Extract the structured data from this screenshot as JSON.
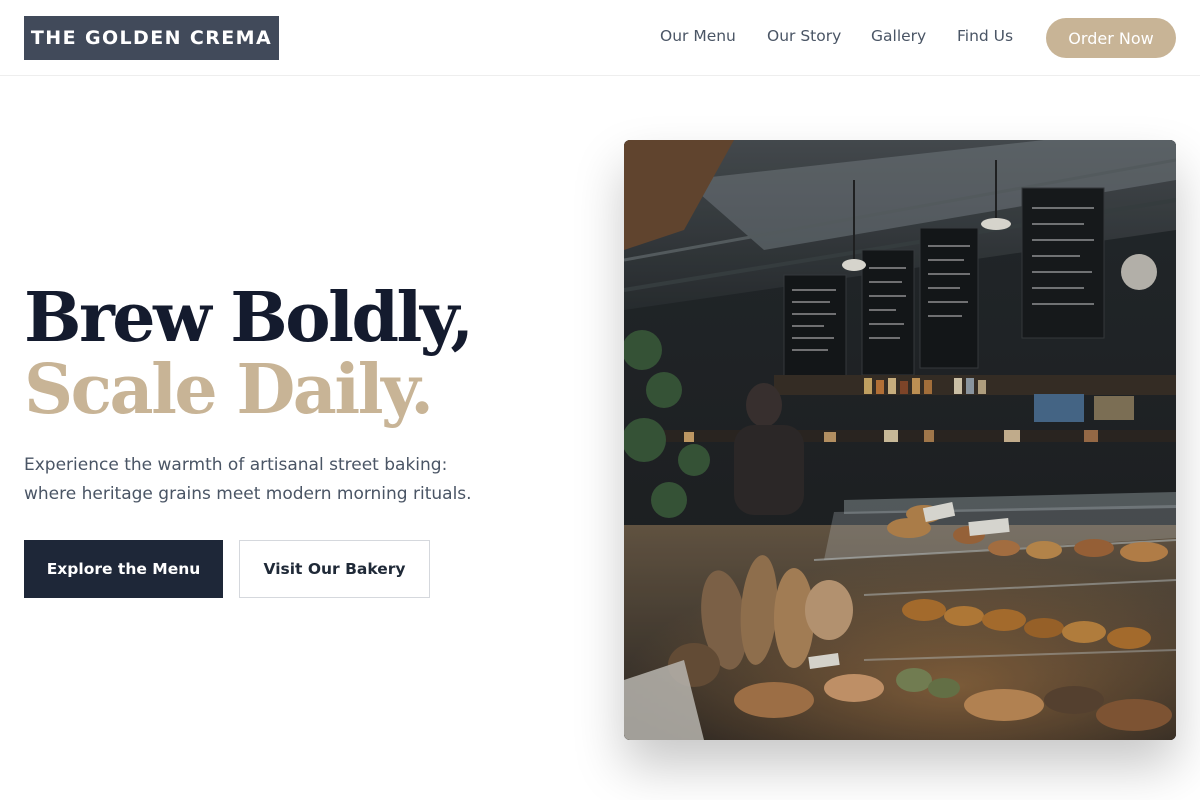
{
  "brand": {
    "name": "THE GOLDEN CREMA"
  },
  "nav": {
    "items": [
      {
        "label": "Our Menu"
      },
      {
        "label": "Our Story"
      },
      {
        "label": "Gallery"
      },
      {
        "label": "Find Us"
      }
    ],
    "cta_label": "Order Now"
  },
  "hero": {
    "headline_line1": "Brew Boldly,",
    "headline_line2": "Scale Daily.",
    "subtitle": "Experience the warmth of artisanal street baking: where heritage grains meet modern morning rituals.",
    "primary_button": "Explore the Menu",
    "secondary_button": "Visit Our Bakery"
  },
  "colors": {
    "logo_bg": "#414a5a",
    "accent_gold": "#c8b496",
    "headline_dark": "#141b2e",
    "button_dark": "#1e2738",
    "body_text": "#4a5565"
  }
}
